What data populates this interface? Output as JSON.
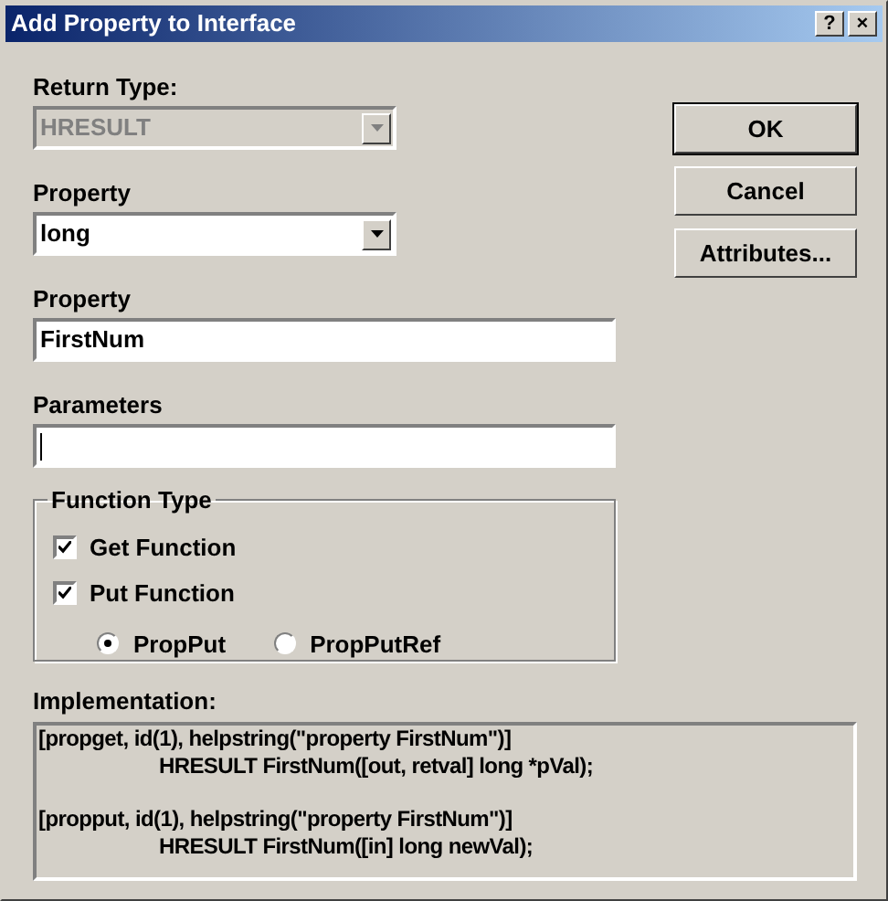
{
  "window": {
    "title": "Add Property to Interface",
    "title_buttons": [
      "?",
      "×"
    ]
  },
  "return_type": {
    "label": "Return Type:",
    "value": "HRESULT",
    "disabled": true
  },
  "property_type": {
    "label": "Property",
    "value": "long",
    "disabled": false
  },
  "property_name": {
    "label": "Property",
    "value": "FirstNum"
  },
  "parameters": {
    "label": "Parameters",
    "focused": true
  },
  "function_type": {
    "label": "Function Type",
    "checkboxes": [
      {
        "label": "Get Function",
        "checked": true
      },
      {
        "label": "Put Function",
        "checked": true
      }
    ],
    "radios": [
      {
        "label": "PropPut",
        "selected": true
      },
      {
        "label": "PropPutRef",
        "selected": false
      }
    ]
  },
  "implementation": {
    "label": "Implementation:",
    "blocks": [
      {
        "attributes": "[propget, id(1), helpstring(\"property FirstNum\")]",
        "declaration": "HRESULT FirstNum([out, retval] long *pVal);"
      },
      {
        "attributes": "[propput, id(1), helpstring(\"property FirstNum\")]",
        "declaration": "HRESULT FirstNum([in] long newVal);"
      }
    ]
  },
  "buttons": [
    {
      "label": "OK",
      "default": true
    },
    {
      "label": "Cancel",
      "default": false
    },
    {
      "label": "Attributes...",
      "default": false
    }
  ]
}
